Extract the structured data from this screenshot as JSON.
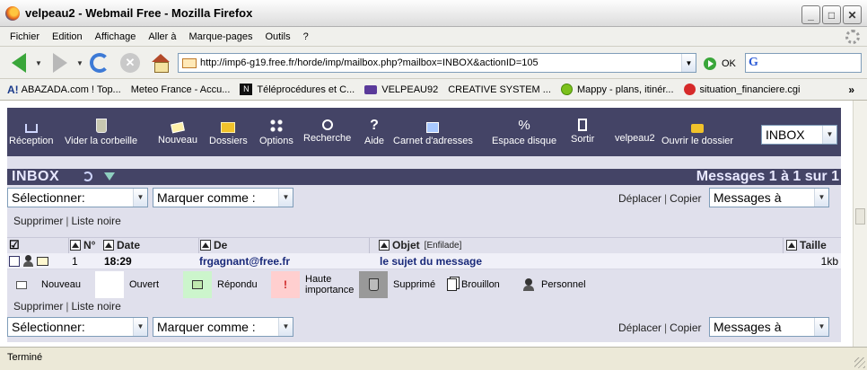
{
  "window": {
    "title": "velpeau2 - Webmail Free - Mozilla Firefox"
  },
  "menu": [
    "Fichier",
    "Edition",
    "Affichage",
    "Aller à",
    "Marque-pages",
    "Outils",
    "?"
  ],
  "nav": {
    "url": "http://imp6-g19.free.fr/horde/imp/mailbox.php?mailbox=INBOX&actionID=105",
    "go_label": "OK"
  },
  "bookmarks": [
    "ABAZADA.com ! Top...",
    "Meteo France - Accu...",
    "Téléprocédures et C...",
    "VELPEAU92",
    "CREATIVE SYSTEM ...",
    "Mappy - plans, itinér...",
    "situation_financiere.cgi"
  ],
  "toolbar": {
    "reception": "Réception",
    "empty_trash": "Vider la corbeille",
    "new": "Nouveau",
    "folders": "Dossiers",
    "options": "Options",
    "search": "Recherche",
    "help": "Aide",
    "address_book": "Carnet d'adresses",
    "disk_space": "Espace disque",
    "logout": "Sortir",
    "username": "velpeau2",
    "open_folder": "Ouvrir le dossier",
    "mailbox": "INBOX"
  },
  "mailbox": {
    "title": "INBOX",
    "count": "Messages 1 à 1 sur 1"
  },
  "controls": {
    "select": "Sélectionner:",
    "mark_as": "Marquer comme :",
    "move": "Déplacer",
    "copy": "Copier",
    "messages_to": "Messages à",
    "delete": "Supprimer",
    "blacklist": "Liste noire"
  },
  "table": {
    "headers": {
      "num": "N°",
      "date": "Date",
      "from": "De",
      "subject": "Objet",
      "thread": "[Enfilade]",
      "size": "Taille"
    },
    "rows": [
      {
        "num": "1",
        "date": "18:29",
        "from": "frgagnant@free.fr",
        "subject": "le sujet du message",
        "size": "1kb"
      }
    ]
  },
  "legend": {
    "new": "Nouveau",
    "opened": "Ouvert",
    "replied": "Répondu",
    "important_1": "Haute",
    "important_2": "importance",
    "deleted": "Supprimé",
    "draft": "Brouillon",
    "personal": "Personnel"
  },
  "legend_colors": {
    "new": "#ffffff",
    "opened": "#ffffff",
    "replied": "#ccf5cc",
    "important": "#ffcfcf",
    "deleted": "#999999"
  },
  "status": "Terminé"
}
